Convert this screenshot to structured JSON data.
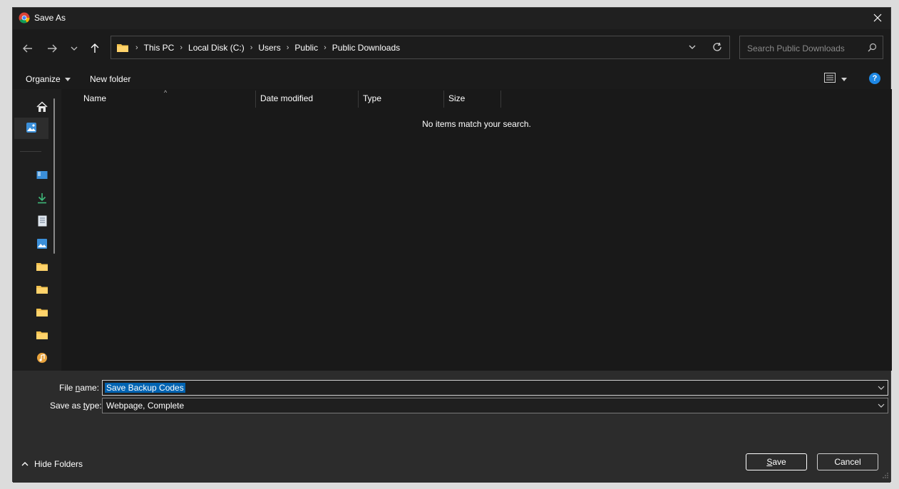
{
  "window": {
    "title": "Save As",
    "app_icon": "chrome-icon"
  },
  "nav": {
    "back_icon": "arrow-left-icon",
    "forward_icon": "arrow-right-icon",
    "recent_icon": "chevron-down-icon",
    "up_icon": "arrow-up-icon"
  },
  "address": {
    "crumbs": [
      "This PC",
      "Local Disk (C:)",
      "Users",
      "Public",
      "Public Downloads"
    ]
  },
  "search": {
    "placeholder": "Search Public Downloads"
  },
  "commands": {
    "organize": "Organize",
    "new_folder": "New folder"
  },
  "columns": [
    "Name",
    "Date modified",
    "Type",
    "Size"
  ],
  "content": {
    "empty_message": "No items match your search."
  },
  "navpane": {
    "items": [
      "home-icon",
      "gallery-icon",
      "desktop-icon",
      "downloads-icon",
      "documents-icon",
      "pictures-icon",
      "folder-icon",
      "folder-icon",
      "folder-icon",
      "folder-icon",
      "music-icon"
    ]
  },
  "form": {
    "file_name_label_pre": "File ",
    "file_name_label_u": "n",
    "file_name_label_post": "ame:",
    "file_name_value": "Save Backup Codes",
    "save_type_label_pre": "Save as ",
    "save_type_label_u": "t",
    "save_type_label_post": "ype:",
    "save_type_value": "Webpage, Complete"
  },
  "buttons": {
    "save_u": "S",
    "save_rest": "ave",
    "cancel": "Cancel",
    "hide_folders": "Hide Folders"
  },
  "colors": {
    "accent": "#0063b1",
    "help": "#1e88e5",
    "folder": "#f2c14e"
  }
}
